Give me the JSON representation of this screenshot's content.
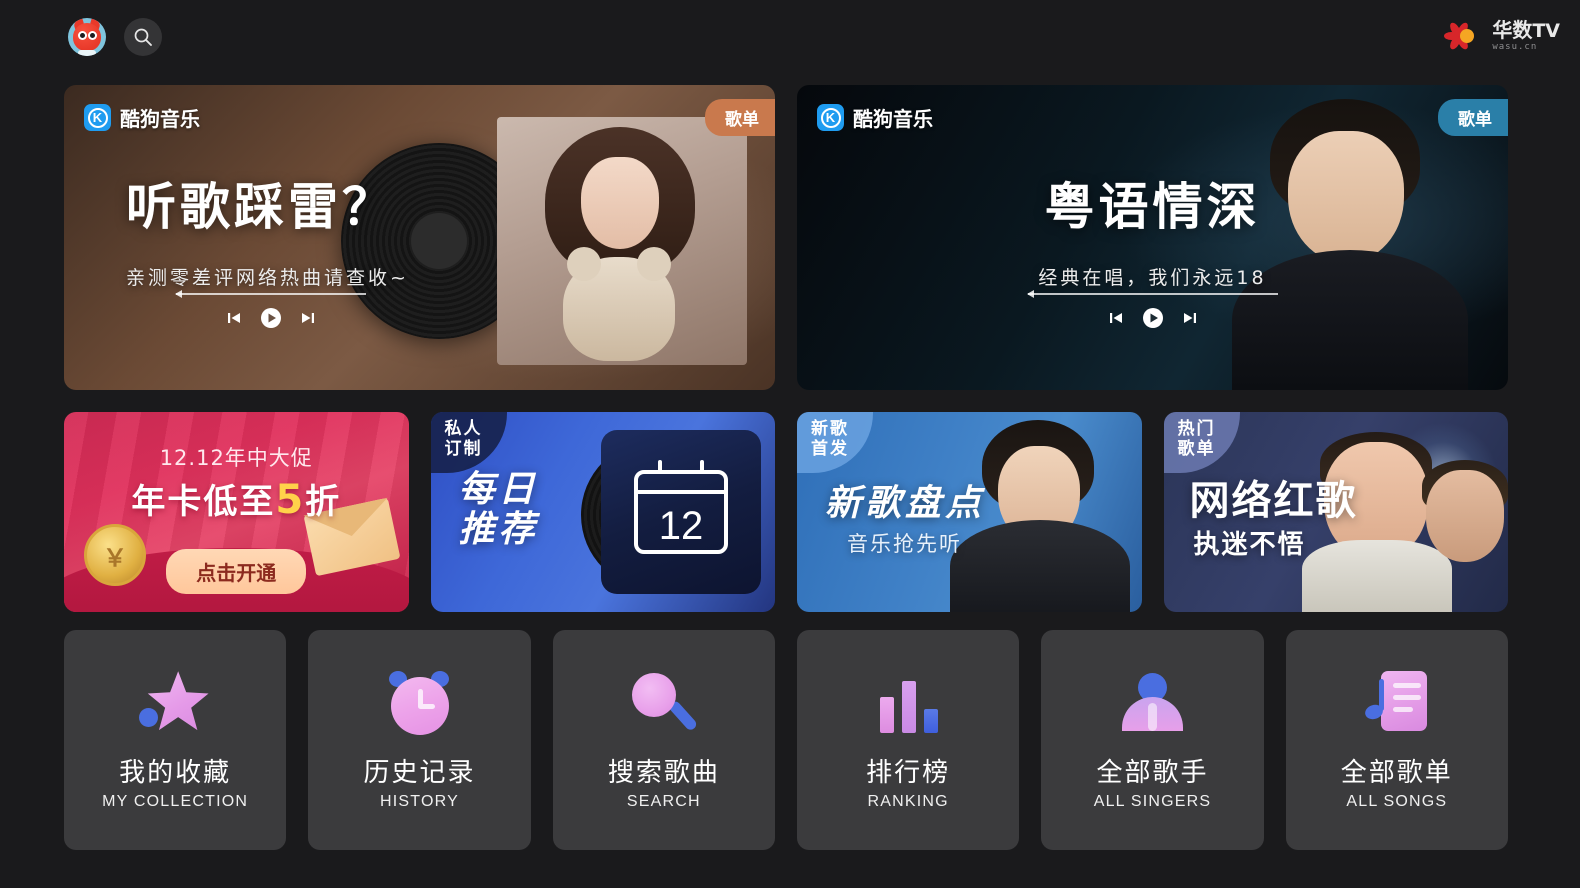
{
  "header": {
    "avatar_name": "user-avatar",
    "search_icon": "search-icon",
    "brand_cn": "华数",
    "brand_tv": "TV",
    "brand_sub": "wasu.cn"
  },
  "banners": [
    {
      "provider": "酷狗音乐",
      "provider_mark": "K",
      "badge": "歌单",
      "title": "听歌踩雷？",
      "subtitle": "亲测零差评网络热曲请查收~",
      "prev_label": "上一首",
      "play_label": "播放",
      "next_label": "下一首",
      "accent": "#c9794d"
    },
    {
      "provider": "酷狗音乐",
      "provider_mark": "K",
      "badge": "歌单",
      "title": "粤语情深",
      "subtitle": "经典在唱，我们永远18",
      "prev_label": "上一首",
      "play_label": "播放",
      "next_label": "下一首",
      "accent": "#2a7fa8"
    }
  ],
  "cards": [
    {
      "kind": "promo",
      "top_text": "12.12年中大促",
      "main_prefix": "年卡低至",
      "main_highlight": "5",
      "main_suffix": "折",
      "button": "点击开通",
      "coin_symbol": "￥",
      "accent": "#e0305c"
    },
    {
      "kind": "daily",
      "tag_line1": "私人",
      "tag_line2": "订制",
      "title_line1": "每日",
      "title_line2": "推荐",
      "calendar_day": "12",
      "accent": "#3e68d8"
    },
    {
      "kind": "newsong",
      "tag_line1": "新歌",
      "tag_line2": "首发",
      "title": "新歌盘点",
      "subtitle": "音乐抢先听",
      "accent": "#3f80c6"
    },
    {
      "kind": "hot",
      "tag_line1": "热门",
      "tag_line2": "歌单",
      "title": "网络红歌",
      "subtitle": "执迷不悟",
      "accent": "#36406a"
    }
  ],
  "tiles": [
    {
      "cn": "我的收藏",
      "en": "MY COLLECTION",
      "icon": "star-icon"
    },
    {
      "cn": "历史记录",
      "en": "HISTORY",
      "icon": "alarm-clock-icon"
    },
    {
      "cn": "搜索歌曲",
      "en": "SEARCH",
      "icon": "magnifier-icon"
    },
    {
      "cn": "排行榜",
      "en": "RANKING",
      "icon": "bar-chart-icon"
    },
    {
      "cn": "全部歌手",
      "en": "ALL SINGERS",
      "icon": "singer-icon"
    },
    {
      "cn": "全部歌单",
      "en": "ALL SONGS",
      "icon": "playlist-icon"
    }
  ],
  "theme": {
    "background": "#1a1a1c",
    "tile_background": "#3b3b3d",
    "text_primary": "#ffffff"
  }
}
